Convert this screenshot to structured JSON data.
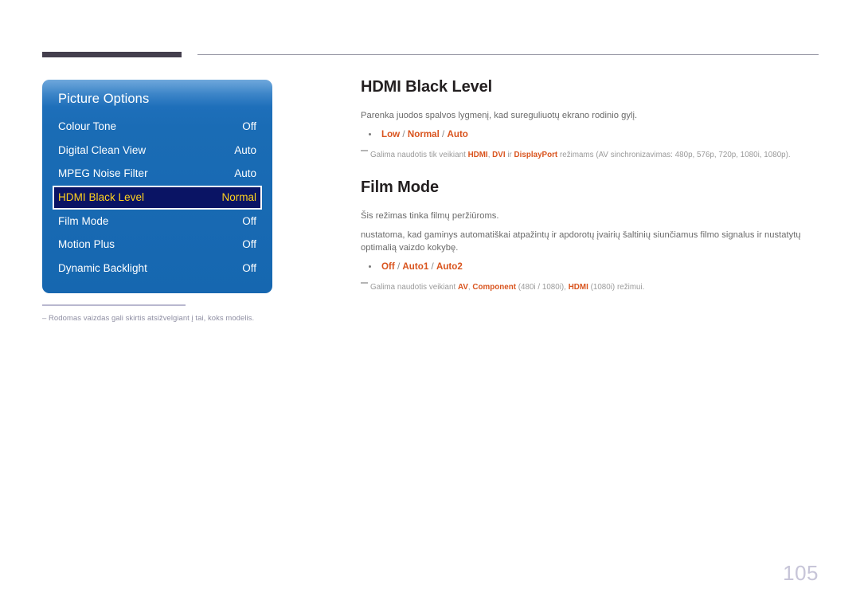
{
  "page": {
    "number": "105"
  },
  "osd": {
    "title": "Picture Options",
    "rows": [
      {
        "label": "Colour Tone",
        "value": "Off",
        "selected": false
      },
      {
        "label": "Digital Clean View",
        "value": "Auto",
        "selected": false
      },
      {
        "label": "MPEG Noise Filter",
        "value": "Auto",
        "selected": false
      },
      {
        "label": "HDMI Black Level",
        "value": "Normal",
        "selected": true
      },
      {
        "label": "Film Mode",
        "value": "Off",
        "selected": false
      },
      {
        "label": "Motion Plus",
        "value": "Off",
        "selected": false
      },
      {
        "label": "Dynamic Backlight",
        "value": "Off",
        "selected": false
      }
    ],
    "footnote": "Rodomas vaizdas gali skirtis atsižvelgiant į tai, koks modelis."
  },
  "sections": {
    "hdmi_black_level": {
      "title": "HDMI Black Level",
      "description": "Parenka juodos spalvos lygmenį, kad sureguliuotų ekrano rodinio gylį.",
      "options": {
        "opt1": "Low",
        "opt2": "Normal",
        "opt3": "Auto"
      },
      "note": {
        "pre": "Galima naudotis tik veikiant ",
        "b1": "HDMI",
        "mid1": ", ",
        "b2": "DVI",
        "mid2": " ir ",
        "b3": "DisplayPort",
        "post": " režimams (AV sinchronizavimas: 480p, 576p, 720p, 1080i, 1080p)."
      }
    },
    "film_mode": {
      "title": "Film Mode",
      "description1": "Šis režimas tinka filmų peržiūroms.",
      "description2": "nustatoma, kad gaminys automatiškai atpažintų ir apdorotų įvairių šaltinių siunčiamus filmo signalus ir nustatytų optimalią vaizdo kokybę.",
      "options": {
        "opt1": "Off",
        "opt2": "Auto1",
        "opt3": "Auto2"
      },
      "note": {
        "pre": "Galima naudotis veikiant ",
        "b1": "AV",
        "mid1": ", ",
        "b2": "Component",
        "mid2": " (480i / 1080i), ",
        "b3": "HDMI",
        "post": " (1080i) režimui."
      }
    }
  },
  "colors": {
    "accent_orange": "#d9541e",
    "osd_blue": "#1667b0",
    "osd_selected_bg": "#0a1464",
    "osd_selected_text": "#ffd21e",
    "page_number": "#c7c5d8"
  }
}
